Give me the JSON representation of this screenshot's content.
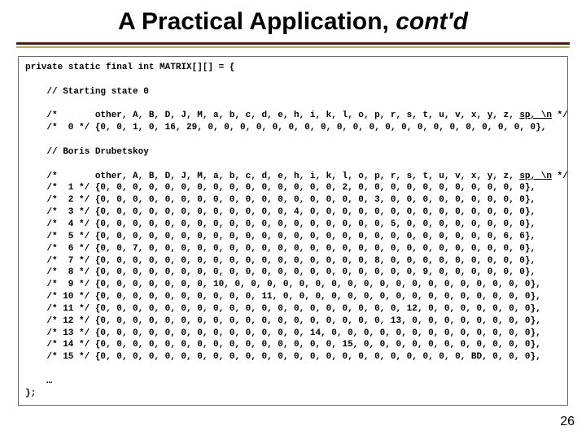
{
  "title_a": "A Practical Application, ",
  "title_b": "cont'd",
  "code": {
    "decl": "private static final int MATRIX[][] = {",
    "start_comment": "    // Starting state 0",
    "hdr_pre": "    /*       other, A, B, D, J, M, a, b, c, d, e, h, i, k, l, o, p, r, s, t, u, v, x, y, z, ",
    "hdr_mid": "sp, \\n",
    "hdr_post": " */",
    "row0": "    /*  0 */ {0, 0, 1, 0, 16, 29, 0, 0, 0, 0, 0, 0, 0, 0, 0, 0, 0, 0, 0, 0, 0, 0, 0, 0, 0, 0, 0},",
    "boris": "    // Boris Drubetskoy",
    "hdr2_pre": "    /*       other, A, B, D, J, M, a, b, c, d, e, h, i, k, l, o, p, r, s, t, u, v, x, y, z, ",
    "hdr2_mid": "sp, \\n",
    "hdr2_post": " */",
    "rows": [
      "    /*  1 */ {0, 0, 0, 0, 0, 0, 0, 0, 0, 0, 0, 0, 0, 0, 0, 2, 0, 0, 0, 0, 0, 0, 0, 0, 0, 0, 0},",
      "    /*  2 */ {0, 0, 0, 0, 0, 0, 0, 0, 0, 0, 0, 0, 0, 0, 0, 0, 0, 3, 0, 0, 0, 0, 0, 0, 0, 0, 0},",
      "    /*  3 */ {0, 0, 0, 0, 0, 0, 0, 0, 0, 0, 0, 0, 4, 0, 0, 0, 0, 0, 0, 0, 0, 0, 0, 0, 0, 0, 0},",
      "    /*  4 */ {0, 0, 0, 0, 0, 0, 0, 0, 0, 0, 0, 0, 0, 0, 0, 0, 0, 0, 5, 0, 0, 0, 0, 0, 0, 0, 0},",
      "    /*  5 */ {0, 0, 0, 0, 0, 0, 0, 0, 0, 0, 0, 0, 0, 0, 0, 0, 0, 0, 0, 0, 0, 0, 0, 0, 0, 6, 6},",
      "    /*  6 */ {0, 0, 7, 0, 0, 0, 0, 0, 0, 0, 0, 0, 0, 0, 0, 0, 0, 0, 0, 0, 0, 0, 0, 0, 0, 0, 0},",
      "    /*  7 */ {0, 0, 0, 0, 0, 0, 0, 0, 0, 0, 0, 0, 0, 0, 0, 0, 0, 8, 0, 0, 0, 0, 0, 0, 0, 0, 0},",
      "    /*  8 */ {0, 0, 0, 0, 0, 0, 0, 0, 0, 0, 0, 0, 0, 0, 0, 0, 0, 0, 0, 0, 9, 0, 0, 0, 0, 0, 0},",
      "    /*  9 */ {0, 0, 0, 0, 0, 0, 0, 10, 0, 0, 0, 0, 0, 0, 0, 0, 0, 0, 0, 0, 0, 0, 0, 0, 0, 0, 0},",
      "    /* 10 */ {0, 0, 0, 0, 0, 0, 0, 0, 0, 0, 11, 0, 0, 0, 0, 0, 0, 0, 0, 0, 0, 0, 0, 0, 0, 0, 0},",
      "    /* 11 */ {0, 0, 0, 0, 0, 0, 0, 0, 0, 0, 0, 0, 0, 0, 0, 0, 0, 0, 0, 12, 0, 0, 0, 0, 0, 0, 0},",
      "    /* 12 */ {0, 0, 0, 0, 0, 0, 0, 0, 0, 0, 0, 0, 0, 0, 0, 0, 0, 0, 13, 0, 0, 0, 0, 0, 0, 0, 0},",
      "    /* 13 */ {0, 0, 0, 0, 0, 0, 0, 0, 0, 0, 0, 0, 0, 14, 0, 0, 0, 0, 0, 0, 0, 0, 0, 0, 0, 0, 0},",
      "    /* 14 */ {0, 0, 0, 0, 0, 0, 0, 0, 0, 0, 0, 0, 0, 0, 0, 15, 0, 0, 0, 0, 0, 0, 0, 0, 0, 0, 0},",
      "    /* 15 */ {0, 0, 0, 0, 0, 0, 0, 0, 0, 0, 0, 0, 0, 0, 0, 0, 0, 0, 0, 0, 0, 0, 0, BD, 0, 0, 0},"
    ],
    "ellipsis": "    …",
    "close": "};"
  },
  "page_number": "26"
}
